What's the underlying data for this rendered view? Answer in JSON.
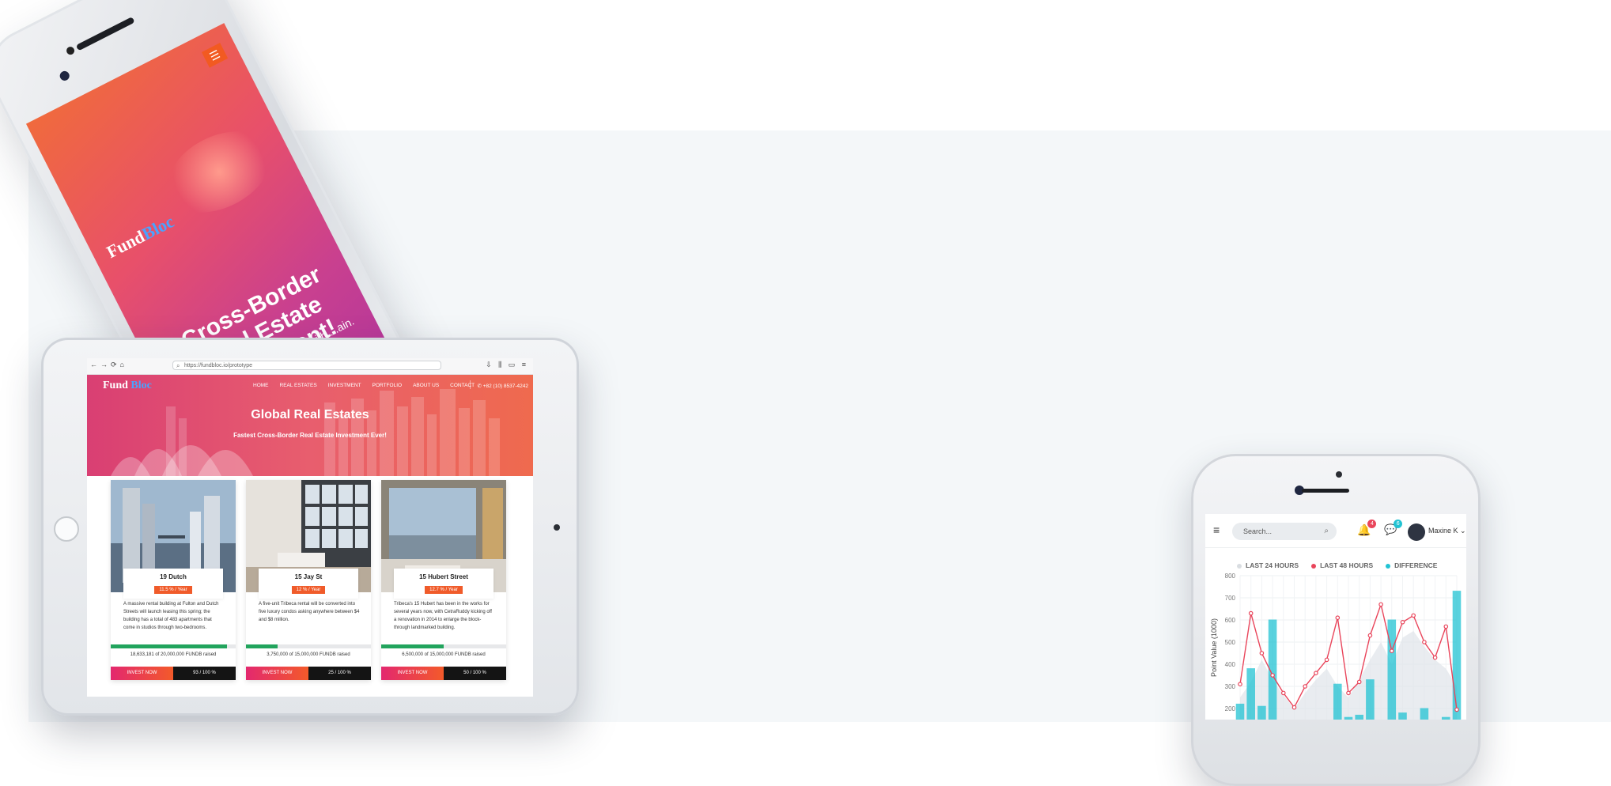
{
  "phone_left": {
    "logo_a": "Fund",
    "logo_b": "Bloc",
    "menu_icon": "☰",
    "hero_title": "Cross-Border Real Estate Investment!",
    "hero_sub": "Real Estate Investment with ...ain."
  },
  "tablet": {
    "browser": {
      "nav_icons": "←→⟳⌂",
      "url": "https://fundbloc.io/prototype",
      "tool_icons": "⇩ ⫼ ▭ ≡"
    },
    "site": {
      "logo_a": "Fund",
      "logo_b": "Bloc",
      "menu": [
        "HOME",
        "REAL ESTATES",
        "INVESTMENT",
        "PORTFOLIO",
        "ABOUT US",
        "CONTACT"
      ],
      "phone": "✆ +82 (10) 8537-4242",
      "hero_title": "Global Real Estates",
      "hero_sub": "Fastest Cross-Border Real Estate Investment Ever!"
    },
    "cards": [
      {
        "name": "19 Dutch",
        "rate": "11.5 % / Year",
        "desc": "A massive rental building at Fulton and Dutch Streets will launch leasing this spring; the building has a total of 483 apartments that come in studios through two-bedrooms.",
        "progress": 0.93,
        "raised": "18,633,181 of 20,000,000 FUNDB raised",
        "invest": "INVEST NOW",
        "pct": "93 / 100 %"
      },
      {
        "name": "15 Jay St",
        "rate": "12 % / Year",
        "desc": "A five-unit Tribeca rental will be converted into five luxury condos asking anywhere between $4 and $8 million.",
        "progress": 0.25,
        "raised": "3,750,000 of 15,000,000 FUNDB raised",
        "invest": "INVEST NOW",
        "pct": "25 / 100 %"
      },
      {
        "name": "15 Hubert Street",
        "rate": "12.7 % / Year",
        "desc": "Tribeca's 15 Hubert has been in the works for several years now, with CetraRuddy kicking off a renovation in 2014 to enlarge the block-through landmarked building.",
        "progress": 0.5,
        "raised": "6,500,000 of 15,000,000 FUNDB raised",
        "invest": "INVEST NOW",
        "pct": "50 / 100 %"
      }
    ]
  },
  "phone_right": {
    "menu_icon": "≡",
    "search_placeholder": "Search...",
    "search_icon": "⌕",
    "bell_icon": "🔔",
    "chat_icon": "💬",
    "notif_count": "4",
    "msg_count": "6",
    "user": "Maxine K ⌄",
    "legend": [
      {
        "label": "LAST 24 HOURS",
        "color": "#d9dde1"
      },
      {
        "label": "LAST 48 HOURS",
        "color": "#e9455b"
      },
      {
        "label": "DIFFERENCE",
        "color": "#22c3d3"
      }
    ],
    "y_ticks": [
      "800",
      "700",
      "600",
      "500",
      "400",
      "300",
      "200"
    ],
    "y_label": "Point Value (1000)",
    "colors": {
      "line": "#e9455b",
      "bar": "#22c3d3",
      "area": "#dfe4ea"
    }
  },
  "chart_data": {
    "type": "bar",
    "title": "",
    "xlabel": "",
    "ylabel": "Point Value (1000)",
    "ylim": [
      150,
      800
    ],
    "legend_position": "top",
    "series": [
      {
        "name": "LAST 24 HOURS",
        "type": "area",
        "values": [
          250,
          320,
          420,
          330,
          260,
          200,
          270,
          330,
          380,
          300,
          250,
          330,
          420,
          500,
          400,
          520,
          550,
          480,
          420,
          380,
          300
        ]
      },
      {
        "name": "LAST 48 HOURS",
        "type": "line",
        "values": [
          310,
          630,
          450,
          350,
          270,
          205,
          300,
          360,
          420,
          610,
          270,
          320,
          530,
          670,
          460,
          590,
          620,
          500,
          430,
          570,
          195
        ]
      },
      {
        "name": "DIFFERENCE",
        "type": "bar",
        "values": [
          220,
          380,
          210,
          600,
          0,
          0,
          0,
          0,
          0,
          310,
          160,
          170,
          330,
          0,
          600,
          180,
          0,
          200,
          0,
          160,
          730
        ]
      }
    ]
  }
}
